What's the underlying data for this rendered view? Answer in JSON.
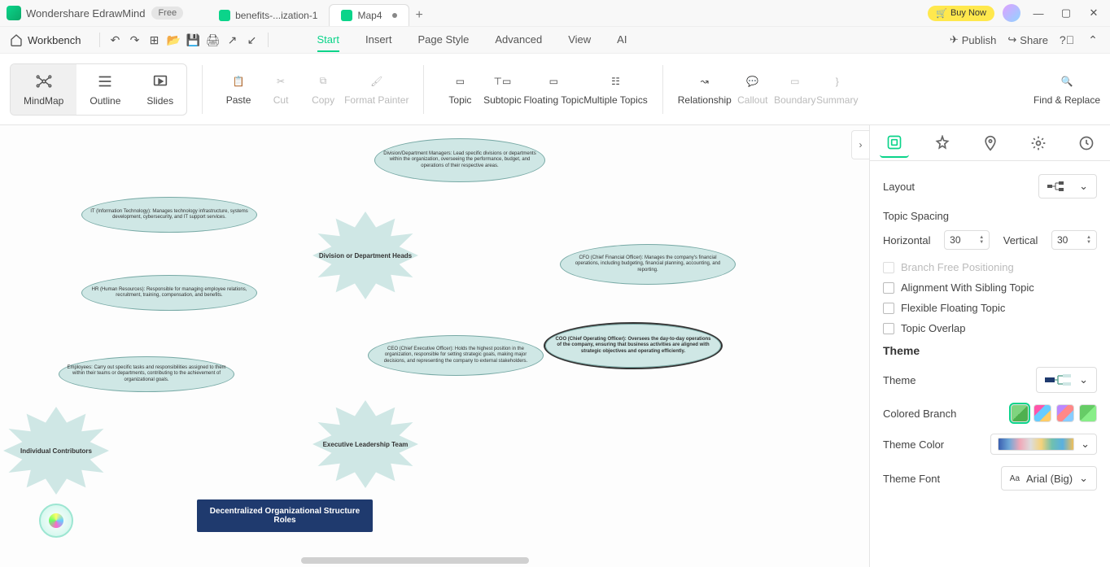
{
  "app": {
    "name": "Wondershare EdrawMind",
    "badge": "Free"
  },
  "tabs": [
    {
      "label": "benefits-...ization-1",
      "active": false
    },
    {
      "label": "Map4",
      "active": true,
      "dirty": true
    }
  ],
  "title_actions": {
    "buy": "Buy Now"
  },
  "topbar": {
    "workbench": "Workbench",
    "menus": [
      "Start",
      "Insert",
      "Page Style",
      "Advanced",
      "View",
      "AI"
    ],
    "active_menu": 0,
    "publish": "Publish",
    "share": "Share"
  },
  "ribbon": {
    "view_modes": [
      "MindMap",
      "Outline",
      "Slides"
    ],
    "active_view": 0,
    "clipboard": [
      "Paste",
      "Cut",
      "Copy",
      "Format Painter"
    ],
    "topics": [
      "Topic",
      "Subtopic",
      "Floating Topic",
      "Multiple Topics"
    ],
    "extras": [
      "Relationship",
      "Callout",
      "Boundary",
      "Summary"
    ],
    "find": "Find & Replace"
  },
  "canvas_nodes": {
    "root": "Decentralized Organizational Structure Roles",
    "n1": "Division/Department Managers: Lead specific divisions or departments within the organization, overseeing the performance, budget, and operations of their respective areas.",
    "n2": "IT (Information Technology): Manages technology infrastructure, systems development, cybersecurity, and IT support services.",
    "n3": "HR (Human Resources): Responsible for managing employee relations, recruitment, training, compensation, and benefits.",
    "n4": "Employees: Carry out specific tasks and responsibilities assigned to them within their teams or departments, contributing to the achievement of organizational goals.",
    "n5": "Division or Department Heads",
    "n6": "Individual Contributors",
    "n7": "Executive Leadership Team",
    "n8": "CEO (Chief Executive Officer): Holds the highest position in the organization, responsible for setting strategic goals, making major decisions, and representing the company to external stakeholders.",
    "n9": "CFO (Chief Financial Officer): Manages the company's financial operations, including budgeting, financial planning, accounting, and reporting.",
    "n10": "COO (Chief Operating Officer): Oversees the day-to-day operations of the company, ensuring that business activities are aligned with strategic objectives and operating efficiently."
  },
  "panel": {
    "layout_label": "Layout",
    "spacing_label": "Topic Spacing",
    "horizontal_label": "Horizontal",
    "vertical_label": "Vertical",
    "horizontal_value": "30",
    "vertical_value": "30",
    "chk_branch_free": "Branch Free Positioning",
    "chk_align_sibling": "Alignment With Sibling Topic",
    "chk_flex_float": "Flexible Floating Topic",
    "chk_overlap": "Topic Overlap",
    "theme_section": "Theme",
    "theme_label": "Theme",
    "colored_branch": "Colored Branch",
    "theme_color": "Theme Color",
    "theme_font": "Theme Font",
    "theme_font_value": "Arial (Big)"
  }
}
